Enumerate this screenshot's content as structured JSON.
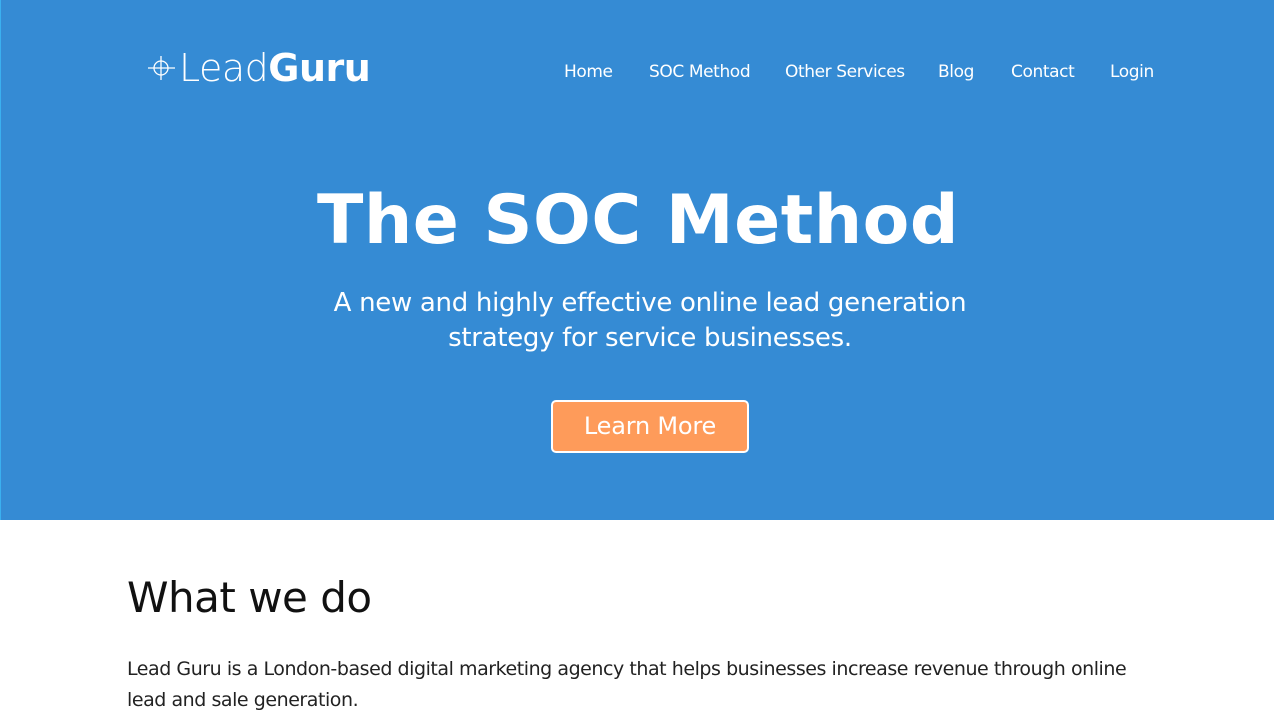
{
  "brand": {
    "name_light": "Lead",
    "name_bold": "Guru",
    "icon": "crosshair-icon"
  },
  "nav": {
    "items": [
      {
        "label": "Home"
      },
      {
        "label": "SOC Method"
      },
      {
        "label": "Other Services"
      },
      {
        "label": "Blog"
      },
      {
        "label": "Contact"
      },
      {
        "label": "Login"
      }
    ]
  },
  "hero": {
    "title": "The SOC Method",
    "subtitle": "A new and highly effective online lead generation strategy for service businesses.",
    "cta_label": "Learn More"
  },
  "about": {
    "heading": "What we do",
    "body": "Lead Guru is a London-based digital marketing agency that helps businesses increase revenue through online lead and sale generation."
  },
  "colors": {
    "hero_background": "#358bd4",
    "cta_background": "#fe9b5a",
    "text_on_hero": "#ffffff",
    "body_text": "#222222"
  }
}
